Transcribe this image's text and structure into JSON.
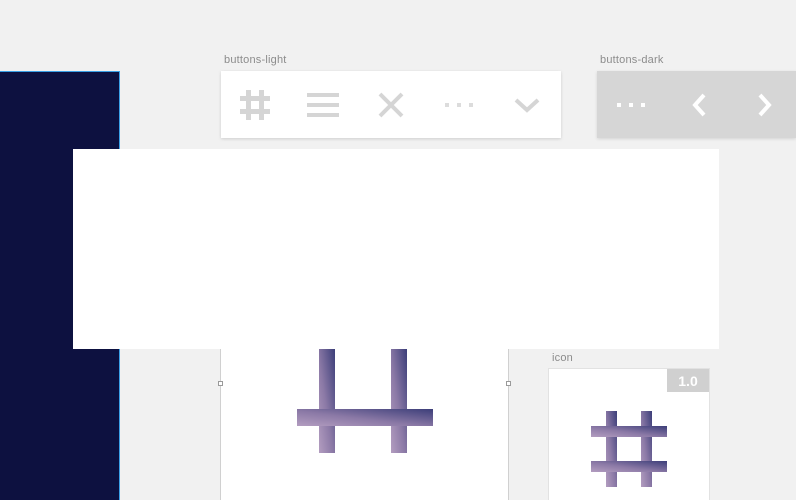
{
  "artboards": {
    "buttons_light": {
      "label": "buttons-light"
    },
    "buttons_dark": {
      "label": "buttons-dark"
    },
    "icon": {
      "label": "icon",
      "scale_badge": "1.0"
    }
  },
  "icons": {
    "light_buttons": [
      "hash-icon",
      "menu-icon",
      "close-icon",
      "more-icon",
      "chevron-down-icon"
    ],
    "dark_buttons": [
      "more-icon",
      "chevron-left-icon",
      "chevron-right-icon"
    ]
  },
  "colors": {
    "canvas": "#f1f1f1",
    "dark_artboard": "#0d1140",
    "selection": "#3aa0e6",
    "light_icon": "#d5d5d5",
    "dark_button_bg": "#d6d6d6",
    "gradient_start": "#a08bb0",
    "gradient_end": "#3e3f78"
  }
}
